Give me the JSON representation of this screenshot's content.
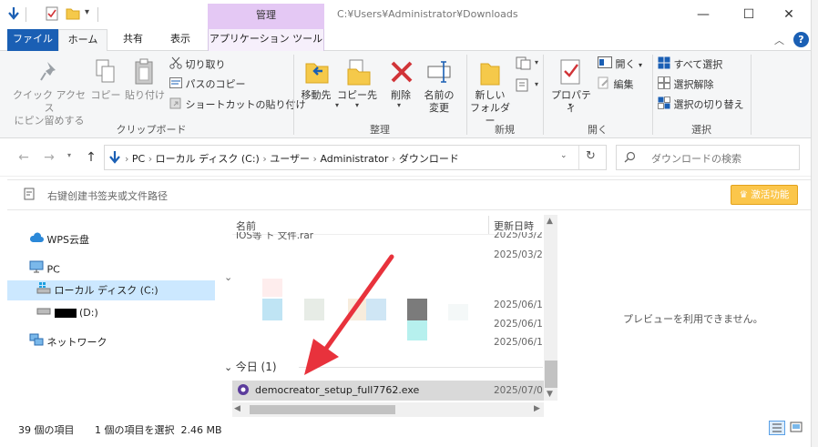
{
  "window": {
    "path_title": "C:¥Users¥Administrator¥Downloads",
    "context_tab_group": "管理",
    "minimize": "—",
    "maximize": "☐",
    "close": "✕"
  },
  "tabs": {
    "file": "ファイル",
    "home": "ホーム",
    "share": "共有",
    "view": "表示",
    "app_tools": "アプリケーション ツール"
  },
  "ribbon": {
    "clipboard": {
      "pin_line1": "クイック アクセス",
      "pin_line2": "にピン留めする",
      "copy": "コピー",
      "paste": "貼り付け",
      "cut": "切り取り",
      "copy_path": "パスのコピー",
      "paste_shortcut": "ショートカットの貼り付け",
      "group": "クリップボード"
    },
    "organize": {
      "move_to": "移動先",
      "copy_to": "コピー先",
      "delete": "削除",
      "rename_line1": "名前の",
      "rename_line2": "変更",
      "group": "整理"
    },
    "new": {
      "new_folder_line1": "新しい",
      "new_folder_line2": "フォルダー",
      "group": "新規"
    },
    "open": {
      "properties": "プロパティ",
      "open": "開く",
      "edit": "編集",
      "group": "開く"
    },
    "select": {
      "select_all": "すべて選択",
      "select_none": "選択解除",
      "invert": "選択の切り替え",
      "group": "選択"
    }
  },
  "address": {
    "crumbs": [
      "PC",
      "ローカル ディスク (C:)",
      "ユーザー",
      "Administrator",
      "ダウンロード"
    ],
    "search_placeholder": "ダウンロードの検索"
  },
  "wps": {
    "hint": "右键创建书签夹或文件路径",
    "activate": "激活功能"
  },
  "navpane": {
    "wps_cloud": "WPS云盘",
    "pc": "PC",
    "local_disk": "ローカル ディスク (C:)",
    "d_drive": "(D:)",
    "network": "ネットワーク"
  },
  "filelist": {
    "col_name": "名前",
    "col_date": "更新日時",
    "partial_row": "IOS等 ト 文件.rar",
    "dates_top": [
      "2025/03/2",
      "2025/03/2"
    ],
    "dates_mid": [
      "2025/06/1",
      "2025/06/1",
      "2025/06/1"
    ],
    "today_group": "今日 (1)",
    "selected_file": "democreator_setup_full7762.exe",
    "selected_date": "2025/07/0"
  },
  "preview": {
    "message": "プレビューを利用できません。"
  },
  "status": {
    "count": "39 個の項目",
    "selection": "1 個の項目を選択  2.46 MB"
  },
  "colors": {
    "accent": "#1a5fb4",
    "manage_tab": "#e4c8f4",
    "selection": "#cce8ff",
    "arrow": "#e8323c",
    "activate": "#fbc64b"
  }
}
